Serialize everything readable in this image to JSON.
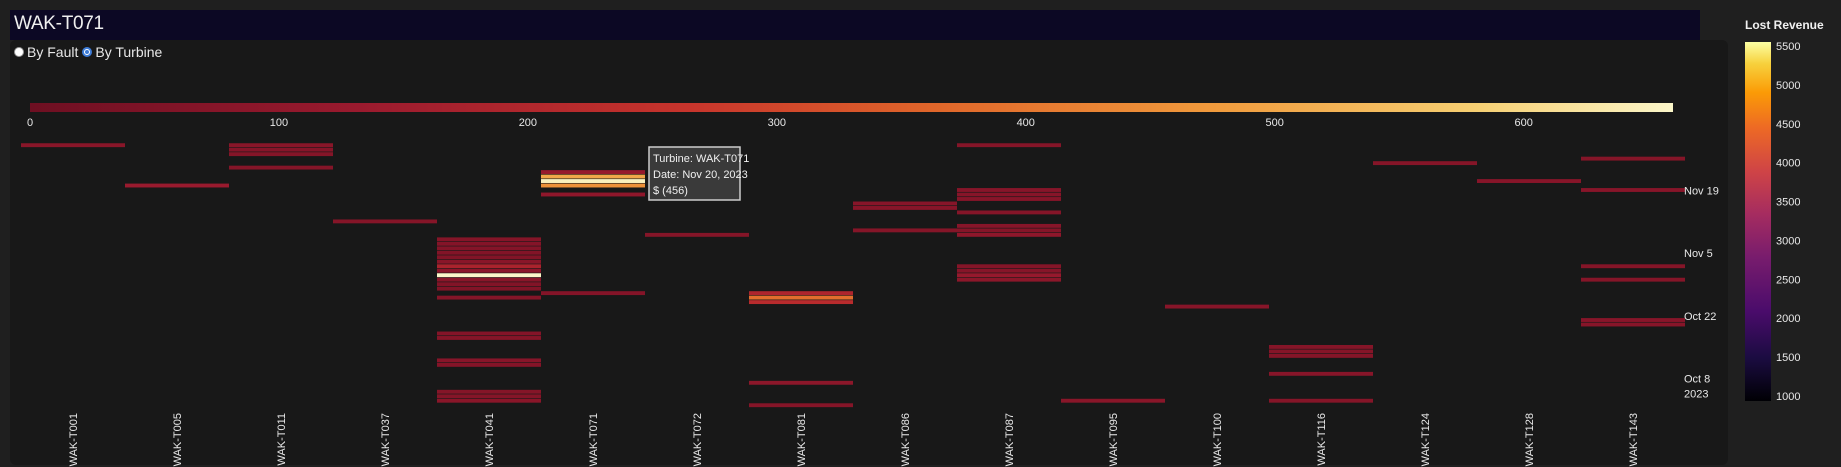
{
  "header": {
    "title": "WAK-T071"
  },
  "toggle": {
    "options": [
      {
        "label": "By Fault",
        "checked": false
      },
      {
        "label": "By Turbine",
        "checked": true
      }
    ]
  },
  "tooltip": {
    "line1": "Turbine: WAK-T071",
    "line2": "Date: Nov 20, 2023",
    "line3": "$ (456)"
  },
  "colors": {
    "panel_bg": "#181818",
    "page_bg": "#1f1f1f",
    "title_bar": "#0c0824",
    "tooltip_border": "#cccccc"
  },
  "chart_data": {
    "type": "heatmap",
    "color_scale": "inferno",
    "top_colorbar": {
      "range": [
        0,
        660
      ],
      "ticks": [
        0,
        100,
        200,
        300,
        400,
        500,
        600
      ]
    },
    "legend": {
      "title": "Lost Revenue",
      "range": [
        1000,
        5500
      ],
      "ticks": [
        5500,
        5000,
        4500,
        4000,
        3500,
        3000,
        2500,
        2000,
        1500,
        1000
      ]
    },
    "x_categories": [
      "WAK-T001",
      "WAK-T005",
      "WAK-T011",
      "WAK-T037",
      "WAK-T041",
      "WAK-T071",
      "WAK-T072",
      "WAK-T081",
      "WAK-T086",
      "WAK-T087",
      "WAK-T095",
      "WAK-T100",
      "WAK-T116",
      "WAK-T124",
      "WAK-T128",
      "WAK-T143"
    ],
    "y_ticks": [
      {
        "label": "Nov 19",
        "date": "2023-11-19"
      },
      {
        "label": "Nov 5",
        "date": "2023-11-05"
      },
      {
        "label": "Oct 22",
        "date": "2023-10-22"
      },
      {
        "label": "Oct 8",
        "sub": "2023",
        "date": "2023-10-08"
      }
    ],
    "y_range": [
      "2023-10-01",
      "2023-11-30"
    ],
    "cells": [
      {
        "turbine": "WAK-T001",
        "date": "2023-11-29",
        "value": 80
      },
      {
        "turbine": "WAK-T005",
        "date": "2023-11-20",
        "value": 130
      },
      {
        "turbine": "WAK-T011",
        "date": "2023-11-29",
        "value": 80
      },
      {
        "turbine": "WAK-T011",
        "date": "2023-11-28",
        "value": 75
      },
      {
        "turbine": "WAK-T011",
        "date": "2023-11-27",
        "value": 70
      },
      {
        "turbine": "WAK-T011",
        "date": "2023-11-24",
        "value": 70
      },
      {
        "turbine": "WAK-T037",
        "date": "2023-11-12",
        "value": 70
      },
      {
        "turbine": "WAK-T041",
        "date": "2023-11-08",
        "value": 70
      },
      {
        "turbine": "WAK-T041",
        "date": "2023-11-07",
        "value": 65
      },
      {
        "turbine": "WAK-T041",
        "date": "2023-11-06",
        "value": 65
      },
      {
        "turbine": "WAK-T041",
        "date": "2023-11-05",
        "value": 60
      },
      {
        "turbine": "WAK-T041",
        "date": "2023-11-04",
        "value": 60
      },
      {
        "turbine": "WAK-T041",
        "date": "2023-11-03",
        "value": 80
      },
      {
        "turbine": "WAK-T041",
        "date": "2023-11-02",
        "value": 180
      },
      {
        "turbine": "WAK-T041",
        "date": "2023-11-01",
        "value": 85
      },
      {
        "turbine": "WAK-T041",
        "date": "2023-10-31",
        "value": 660
      },
      {
        "turbine": "WAK-T041",
        "date": "2023-10-30",
        "value": 80
      },
      {
        "turbine": "WAK-T041",
        "date": "2023-10-29",
        "value": 60
      },
      {
        "turbine": "WAK-T041",
        "date": "2023-10-28",
        "value": 60
      },
      {
        "turbine": "WAK-T041",
        "date": "2023-10-26",
        "value": 70
      },
      {
        "turbine": "WAK-T041",
        "date": "2023-10-18",
        "value": 65
      },
      {
        "turbine": "WAK-T041",
        "date": "2023-10-17",
        "value": 70
      },
      {
        "turbine": "WAK-T041",
        "date": "2023-10-12",
        "value": 75
      },
      {
        "turbine": "WAK-T041",
        "date": "2023-10-11",
        "value": 65
      },
      {
        "turbine": "WAK-T041",
        "date": "2023-10-05",
        "value": 70
      },
      {
        "turbine": "WAK-T041",
        "date": "2023-10-04",
        "value": 70
      },
      {
        "turbine": "WAK-T041",
        "date": "2023-10-03",
        "value": 80
      },
      {
        "turbine": "WAK-T071",
        "date": "2023-11-23",
        "value": 120
      },
      {
        "turbine": "WAK-T071",
        "date": "2023-11-22",
        "value": 500
      },
      {
        "turbine": "WAK-T071",
        "date": "2023-11-21",
        "value": 650
      },
      {
        "turbine": "WAK-T071",
        "date": "2023-11-20",
        "value": 456
      },
      {
        "turbine": "WAK-T071",
        "date": "2023-11-18",
        "value": 100
      },
      {
        "turbine": "WAK-T071",
        "date": "2023-10-27",
        "value": 65
      },
      {
        "turbine": "WAK-T072",
        "date": "2023-11-09",
        "value": 70
      },
      {
        "turbine": "WAK-T081",
        "date": "2023-10-27",
        "value": 190
      },
      {
        "turbine": "WAK-T081",
        "date": "2023-10-26",
        "value": 380
      },
      {
        "turbine": "WAK-T081",
        "date": "2023-10-25",
        "value": 220
      },
      {
        "turbine": "WAK-T081",
        "date": "2023-10-07",
        "value": 90
      },
      {
        "turbine": "WAK-T081",
        "date": "2023-10-02",
        "value": 70
      },
      {
        "turbine": "WAK-T086",
        "date": "2023-11-16",
        "value": 75
      },
      {
        "turbine": "WAK-T086",
        "date": "2023-11-15",
        "value": 75
      },
      {
        "turbine": "WAK-T086",
        "date": "2023-11-10",
        "value": 70
      },
      {
        "turbine": "WAK-T087",
        "date": "2023-11-29",
        "value": 70
      },
      {
        "turbine": "WAK-T087",
        "date": "2023-11-19",
        "value": 75
      },
      {
        "turbine": "WAK-T087",
        "date": "2023-11-18",
        "value": 75
      },
      {
        "turbine": "WAK-T087",
        "date": "2023-11-17",
        "value": 75
      },
      {
        "turbine": "WAK-T087",
        "date": "2023-11-14",
        "value": 70
      },
      {
        "turbine": "WAK-T087",
        "date": "2023-11-11",
        "value": 75
      },
      {
        "turbine": "WAK-T087",
        "date": "2023-11-10",
        "value": 70
      },
      {
        "turbine": "WAK-T087",
        "date": "2023-11-09",
        "value": 100
      },
      {
        "turbine": "WAK-T087",
        "date": "2023-11-02",
        "value": 70
      },
      {
        "turbine": "WAK-T087",
        "date": "2023-11-01",
        "value": 75
      },
      {
        "turbine": "WAK-T087",
        "date": "2023-10-31",
        "value": 120
      },
      {
        "turbine": "WAK-T087",
        "date": "2023-10-30",
        "value": 90
      },
      {
        "turbine": "WAK-T095",
        "date": "2023-10-03",
        "value": 80
      },
      {
        "turbine": "WAK-T100",
        "date": "2023-10-24",
        "value": 75
      },
      {
        "turbine": "WAK-T116",
        "date": "2023-10-15",
        "value": 70
      },
      {
        "turbine": "WAK-T116",
        "date": "2023-10-14",
        "value": 70
      },
      {
        "turbine": "WAK-T116",
        "date": "2023-10-13",
        "value": 70
      },
      {
        "turbine": "WAK-T116",
        "date": "2023-10-09",
        "value": 75
      },
      {
        "turbine": "WAK-T116",
        "date": "2023-10-03",
        "value": 70
      },
      {
        "turbine": "WAK-T124",
        "date": "2023-11-25",
        "value": 70
      },
      {
        "turbine": "WAK-T128",
        "date": "2023-11-21",
        "value": 75
      },
      {
        "turbine": "WAK-T143",
        "date": "2023-11-26",
        "value": 70
      },
      {
        "turbine": "WAK-T143",
        "date": "2023-11-19",
        "value": 75
      },
      {
        "turbine": "WAK-T143",
        "date": "2023-11-02",
        "value": 70
      },
      {
        "turbine": "WAK-T143",
        "date": "2023-10-30",
        "value": 70
      },
      {
        "turbine": "WAK-T143",
        "date": "2023-10-21",
        "value": 75
      },
      {
        "turbine": "WAK-T143",
        "date": "2023-10-20",
        "value": 75
      }
    ]
  }
}
